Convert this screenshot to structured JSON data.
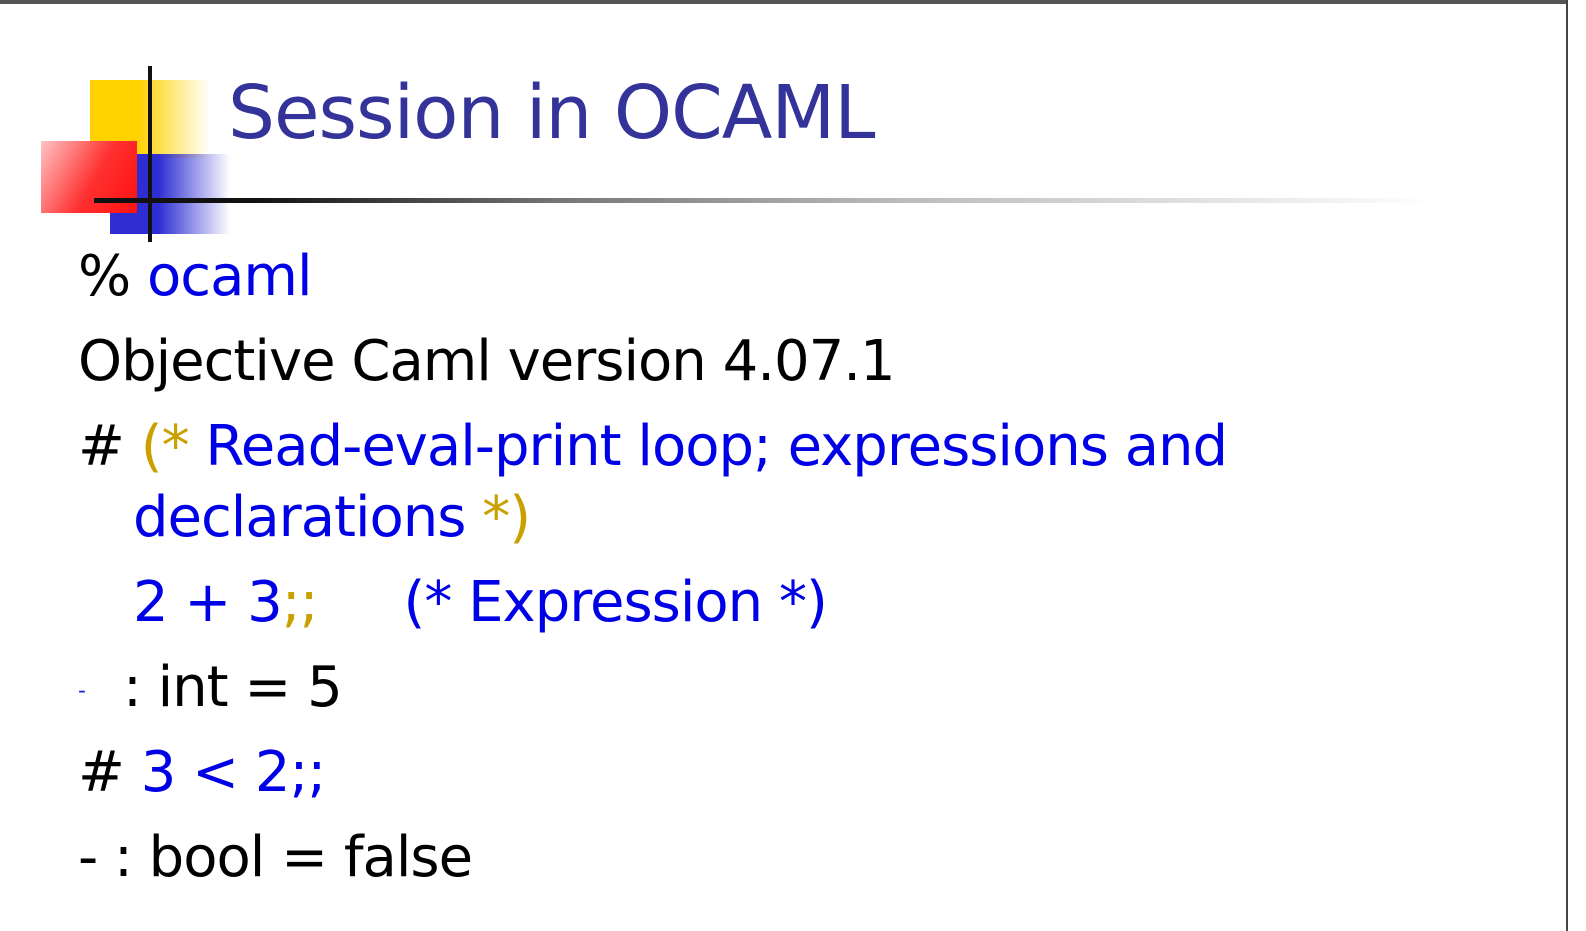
{
  "slide": {
    "title": "Session in OCAML",
    "lines": [
      {
        "prompt": "%",
        "command": "ocaml"
      },
      {
        "text": "Objective Caml version 4.07.1"
      },
      {
        "prompt": "#",
        "comment_open": "(*",
        "comment_text_1": "Read-eval-print loop; expressions and",
        "comment_text_2": "declarations",
        "comment_close_star": "*",
        "comment_close_paren": ")"
      },
      {
        "expr": "2 + 3",
        "terminator": ";;",
        "comment": "(* Expression *)"
      },
      {
        "bullet": "-",
        "result": ": int = 5"
      },
      {
        "prompt": "#",
        "expr": "3 < 2;;"
      },
      {
        "result": "- : bool = false"
      }
    ]
  },
  "colors": {
    "title": "#333399",
    "input": "#0000e6",
    "comment_delim": "#c9a000",
    "output": "#000000"
  }
}
